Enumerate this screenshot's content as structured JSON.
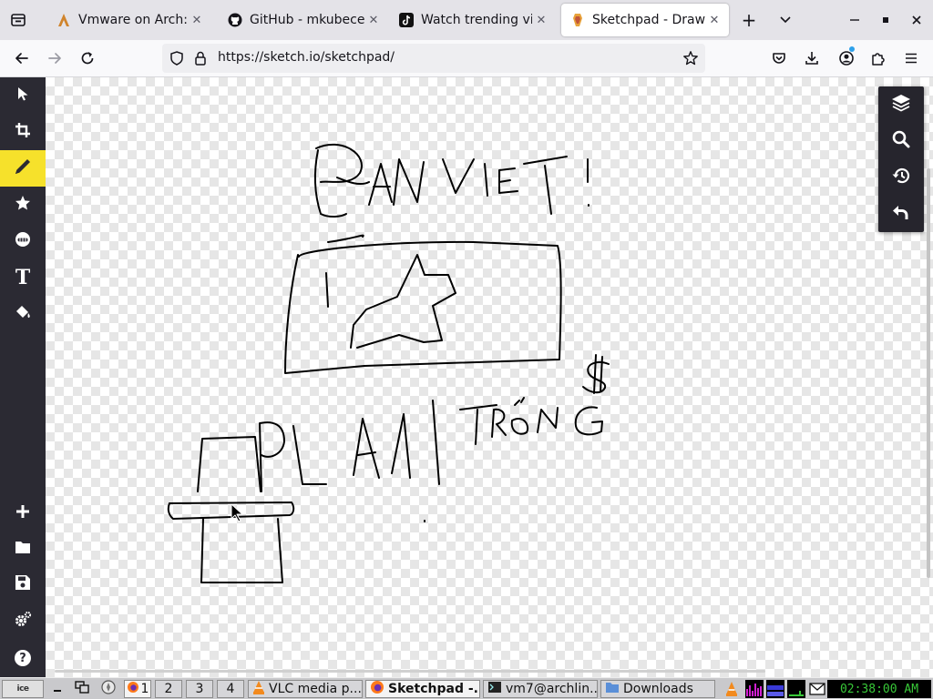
{
  "browser": {
    "tabs": [
      {
        "label": "Vmware on Arch: C",
        "icon": "vmware-arch-favicon",
        "active": false
      },
      {
        "label": "GitHub - mkubecek",
        "icon": "github-icon",
        "active": false
      },
      {
        "label": "Watch trending vid",
        "icon": "tiktok-icon",
        "active": false
      },
      {
        "label": "Sketchpad - Draw, ",
        "icon": "sketchpad-favicon",
        "active": true
      }
    ],
    "url": "https://sketch.io/sketchpad/"
  },
  "sketchpad": {
    "left_tools": [
      "select-arrow-icon",
      "crop-icon",
      "pencil-icon",
      "star-icon",
      "emoji-icon",
      "text-icon",
      "fill-bucket-icon"
    ],
    "text_tool_glyph": "T",
    "active_tool": "pencil-icon",
    "bottom_tools": [
      "plus-icon",
      "folder-icon",
      "save-icon",
      "settings-icon",
      "help-icon"
    ],
    "help_glyph": "?",
    "right_tools": [
      "layers-icon",
      "search-icon",
      "history-icon",
      "undo-icon"
    ]
  },
  "taskbar": {
    "workspaces": [
      "1",
      "2",
      "3",
      "4"
    ],
    "active_workspace": "1",
    "windows": [
      {
        "label": "VLC media p...",
        "icon": "vlc-icon",
        "active": false
      },
      {
        "label": "Sketchpad -...",
        "icon": "firefox-icon",
        "active": true
      },
      {
        "label": "vm7@archlin...",
        "icon": "terminal-icon",
        "active": false
      },
      {
        "label": "Downloads",
        "icon": "folder-icon",
        "active": false
      }
    ],
    "clock": "02:38:00 AM"
  }
}
